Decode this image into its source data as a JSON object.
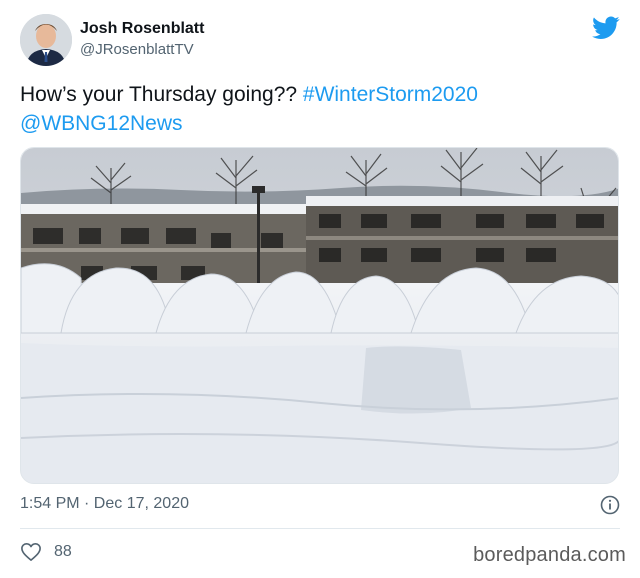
{
  "author": {
    "display_name": "Josh Rosenblatt",
    "handle": "@JRosenblattTV"
  },
  "tweet": {
    "text_plain": "How’s your Thursday going?? ",
    "hashtag": "#WinterStorm2020",
    "mention": "@WBNG12News"
  },
  "media": {
    "icon": "photo-snow-drifts"
  },
  "meta": {
    "timestamp": "1:54 PM · Dec 17, 2020",
    "like_count": "88"
  },
  "watermark": "boredpanda.com",
  "colors": {
    "link": "#1d9bf0",
    "twitter_blue": "#1d9bf0",
    "muted": "#536471"
  },
  "icons": {
    "brand": "twitter-bird-icon",
    "info": "info-icon",
    "like": "heart-icon"
  }
}
